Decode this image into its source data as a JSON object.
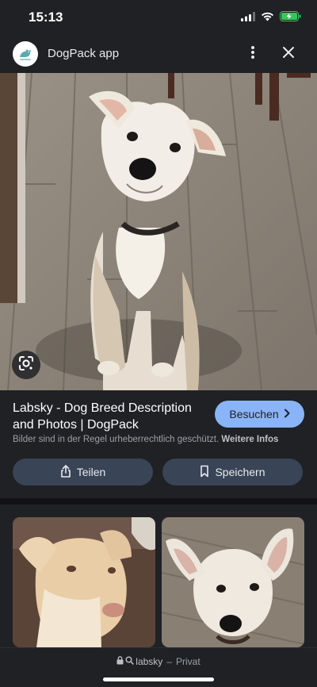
{
  "status_bar": {
    "time": "15:13",
    "icons": [
      "signal-icon",
      "wifi-icon",
      "battery-charging-icon"
    ]
  },
  "header": {
    "app_title": "DogPack app",
    "logo_icon": "dogpack-logo",
    "more_icon": "more-vertical-icon",
    "close_icon": "close-icon"
  },
  "hero": {
    "image_alt": "white dog sitting on wood floor",
    "lens_icon": "lens-icon"
  },
  "result": {
    "title": "Labsky - Dog Breed Description and Photos | DogPack",
    "visit_label": "Besuchen",
    "copyright_text": "Bilder sind in der Regel urheberrechtlich geschützt.",
    "more_info_label": "Weitere Infos",
    "share_label": "Teilen",
    "save_label": "Speichern"
  },
  "related": {
    "thumbnails": [
      {
        "alt": "cream puppy on brown blanket"
      },
      {
        "alt": "white puppy on wood floor"
      }
    ]
  },
  "bottom_bar": {
    "search_query": "labsky",
    "separator": "–",
    "mode_label": "Privat"
  },
  "colors": {
    "background": "#202124",
    "accent": "#8ab4f8",
    "pill": "#394457",
    "battery": "#34c759"
  }
}
